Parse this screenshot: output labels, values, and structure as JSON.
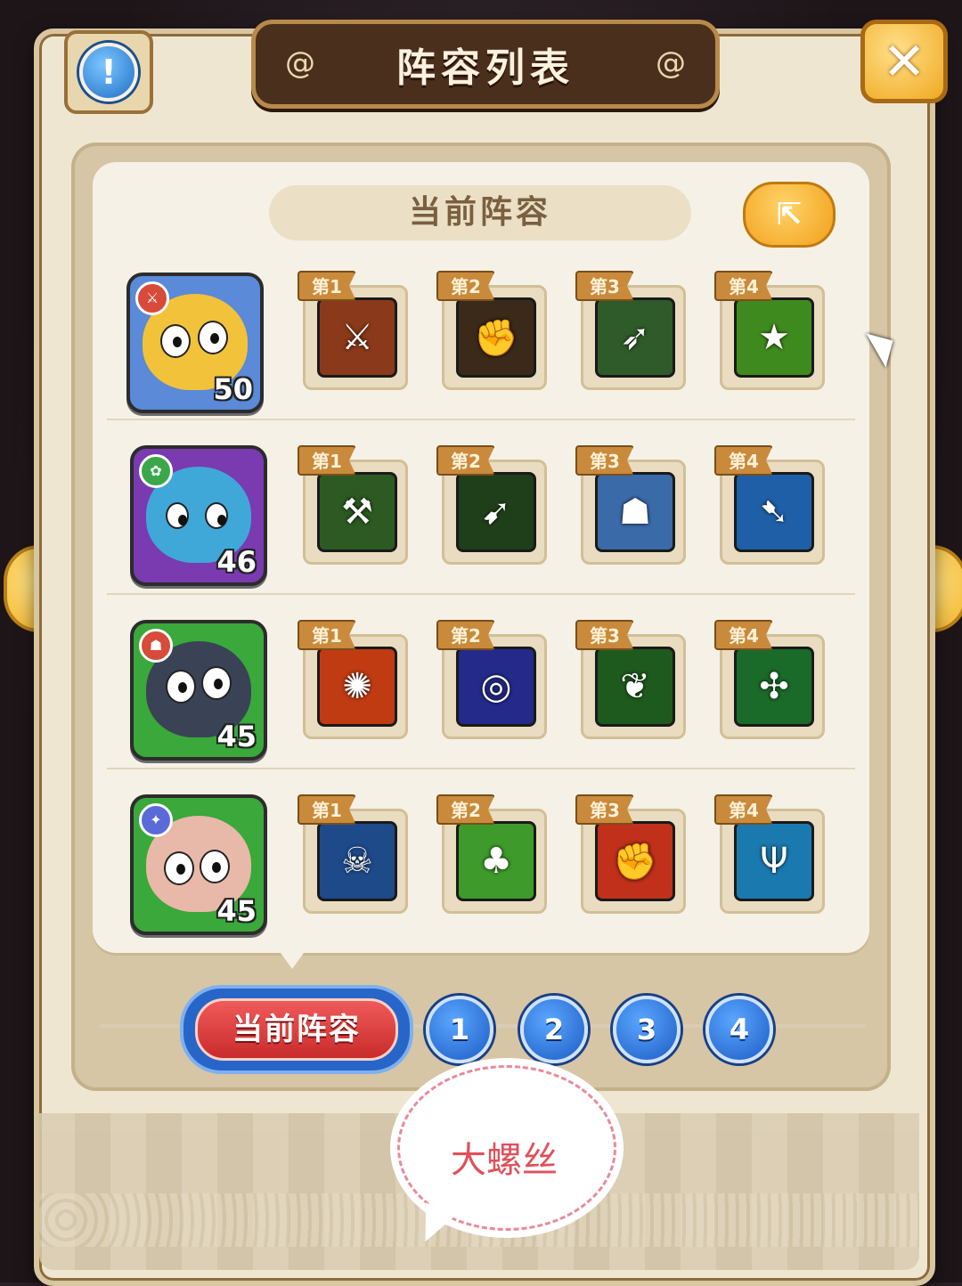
{
  "header": {
    "title": "阵容列表"
  },
  "section": {
    "title": "当前阵容"
  },
  "tabs": {
    "current_label": "当前阵容",
    "numbers": [
      "1",
      "2",
      "3",
      "4"
    ]
  },
  "watermark": {
    "text": "大螺丝"
  },
  "heroes": [
    {
      "level": "50",
      "skills": [
        {
          "tag": "第1",
          "icon": "crossed-swords-icon",
          "color": "#8a3a1a",
          "glyph": "⚔"
        },
        {
          "tag": "第2",
          "icon": "skull-fist-icon",
          "color": "#3b2a1a",
          "glyph": "✊"
        },
        {
          "tag": "第3",
          "icon": "spear-strike-icon",
          "color": "#2f5a2a",
          "glyph": "➶"
        },
        {
          "tag": "第4",
          "icon": "star-shield-icon",
          "color": "#3f8a1e",
          "glyph": "★"
        }
      ]
    },
    {
      "level": "46",
      "skills": [
        {
          "tag": "第1",
          "icon": "panda-warrior-icon",
          "color": "#2c5a22",
          "glyph": "⚒"
        },
        {
          "tag": "第2",
          "icon": "green-spear-icon",
          "color": "#1f3f1a",
          "glyph": "➹"
        },
        {
          "tag": "第3",
          "icon": "tiger-icon",
          "color": "#3a6aa8",
          "glyph": "☗"
        },
        {
          "tag": "第4",
          "icon": "blue-spearhead-icon",
          "color": "#1f5fa8",
          "glyph": "➷"
        }
      ]
    },
    {
      "level": "45",
      "skills": [
        {
          "tag": "第1",
          "icon": "paw-burst-icon",
          "color": "#c03a12",
          "glyph": "✺"
        },
        {
          "tag": "第2",
          "icon": "blue-circle-icon",
          "color": "#242a8a",
          "glyph": "◎"
        },
        {
          "tag": "第3",
          "icon": "vine-icon",
          "color": "#1e5a1e",
          "glyph": "❦"
        },
        {
          "tag": "第4",
          "icon": "green-leaf-icon",
          "color": "#1a6a2a",
          "glyph": "✣"
        }
      ]
    },
    {
      "level": "45",
      "skills": [
        {
          "tag": "第1",
          "icon": "red-mask-icon",
          "color": "#1e4a8a",
          "glyph": "☠"
        },
        {
          "tag": "第2",
          "icon": "clover-field-icon",
          "color": "#3e9a2a",
          "glyph": "♣"
        },
        {
          "tag": "第3",
          "icon": "fire-fist-icon",
          "color": "#c0301a",
          "glyph": "✊"
        },
        {
          "tag": "第4",
          "icon": "ice-trident-icon",
          "color": "#1a7ab0",
          "glyph": "Ψ"
        }
      ]
    }
  ],
  "colors": {
    "hero1_frame": "#5a8ad8",
    "hero1_face": "#f2c23a",
    "hero2_frame": "#7a3ab0",
    "hero2_face": "#3fa8d8",
    "hero3_frame": "#3aa83a",
    "hero3_face": "#3a4256",
    "hero4_frame": "#3aa83a",
    "hero4_face": "#e8b8a8"
  }
}
